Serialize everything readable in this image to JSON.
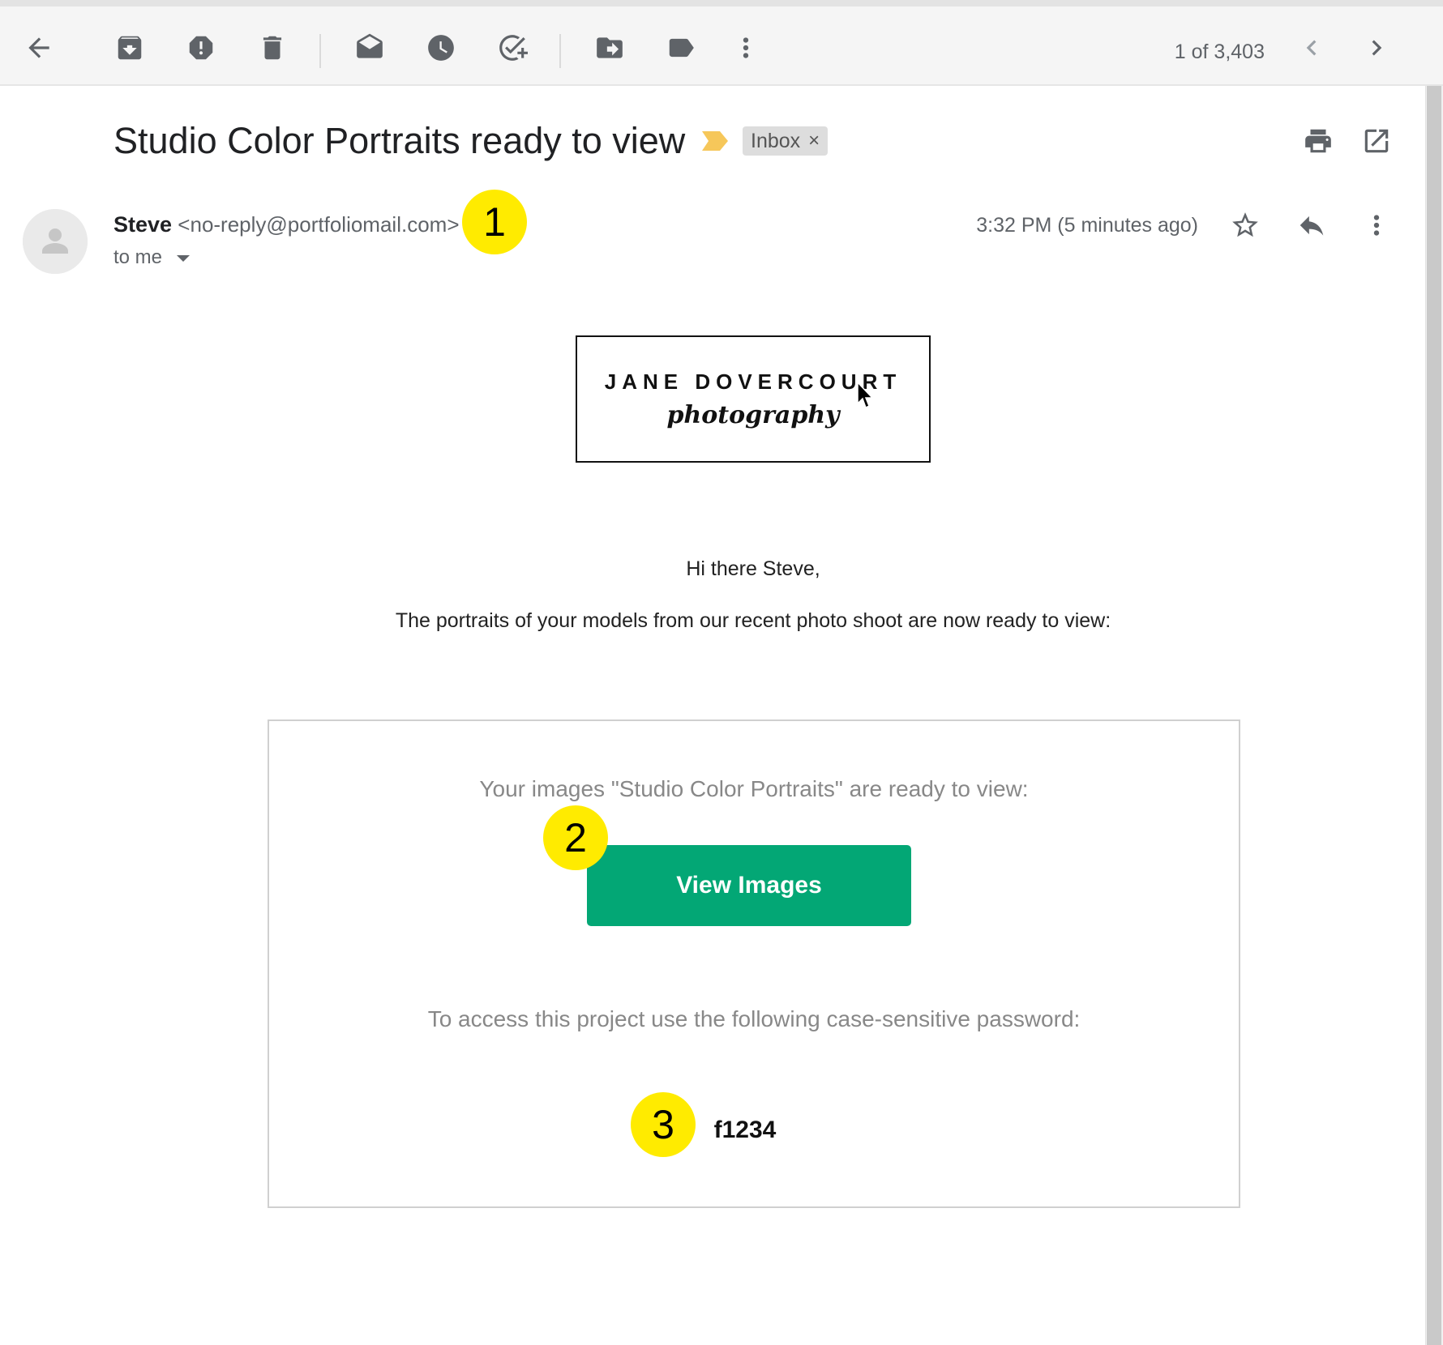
{
  "toolbar": {
    "page_count": "1 of 3,403",
    "icons": [
      "back-arrow-icon",
      "archive-icon",
      "report-spam-icon",
      "delete-icon",
      "mark-unread-icon",
      "snooze-icon",
      "add-task-icon",
      "move-to-icon",
      "label-icon",
      "more-vert-icon",
      "chevron-left-icon",
      "chevron-right-icon"
    ]
  },
  "message": {
    "subject": "Studio Color Portraits ready to view",
    "label_chip": "Inbox",
    "label_chip_close": "×",
    "sender_name": "Steve",
    "sender_email": "<no-reply@portfoliomail.com>",
    "recipient": "to me",
    "timestamp": "3:32 PM (5 minutes ago)"
  },
  "body": {
    "logo_line1": "JANE DOVERCOURT",
    "logo_line2": "photography",
    "greeting": "Hi there Steve,",
    "intro": "The portraits of your models from our recent photo shoot are now ready to view:",
    "card_heading": "Your images \"Studio Color Portraits\" are ready to view:",
    "view_button": "View Images",
    "password_label": "To access this project use the following case-sensitive password:",
    "password": "f1234"
  },
  "callouts": [
    "1",
    "2",
    "3"
  ],
  "colors": {
    "accent_green": "#03a775",
    "callout_yellow": "#ffeb00",
    "importance_marker": "#f6c75a",
    "toolbar_bg": "#f5f5f5"
  }
}
